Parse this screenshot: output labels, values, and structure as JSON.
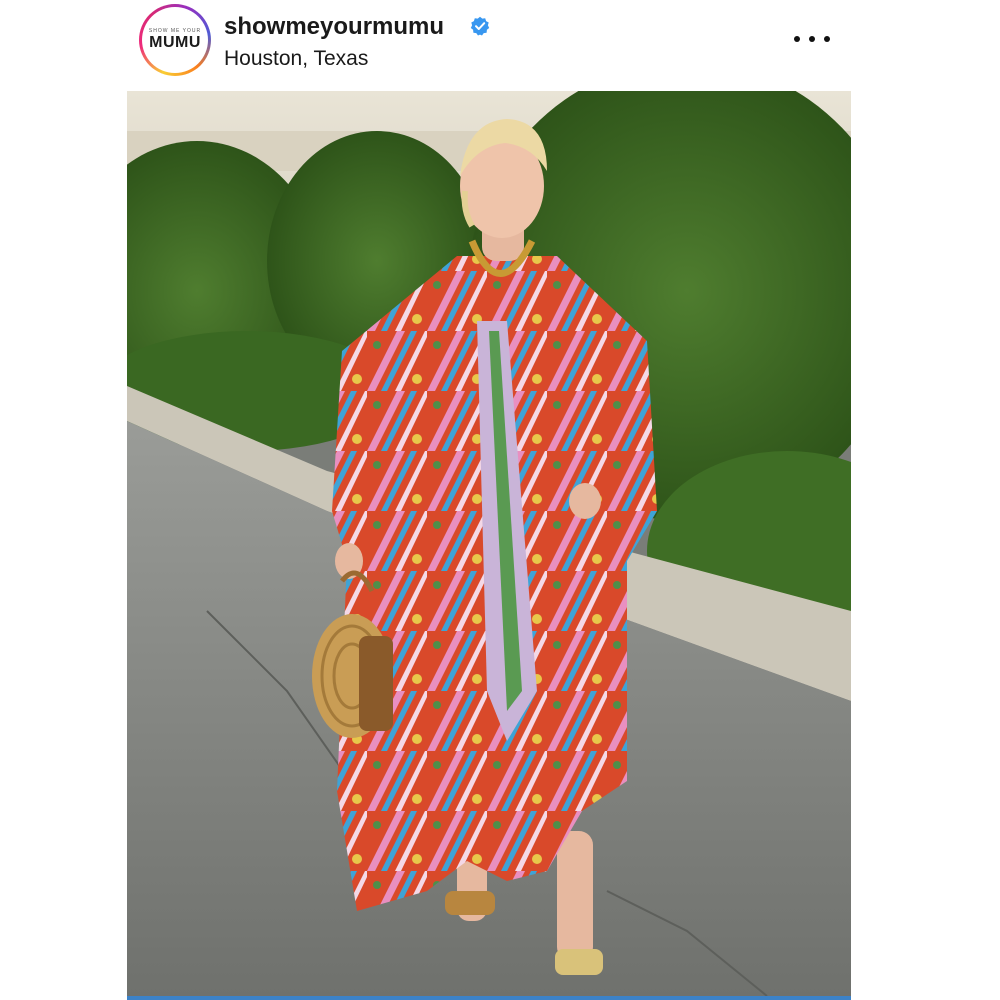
{
  "post": {
    "username": "showmeyourmumu",
    "verified": true,
    "location": "Houston, Texas",
    "avatar": {
      "small_text": "SHOW ME YOUR",
      "logo_text": "MUMU"
    },
    "more_icon": "more-horizontal-icon",
    "verified_icon": "verified-badge-icon"
  },
  "colors": {
    "verified_blue": "#3897f0",
    "text": "#1a1a1a",
    "accent_bar": "#3c82c8"
  }
}
